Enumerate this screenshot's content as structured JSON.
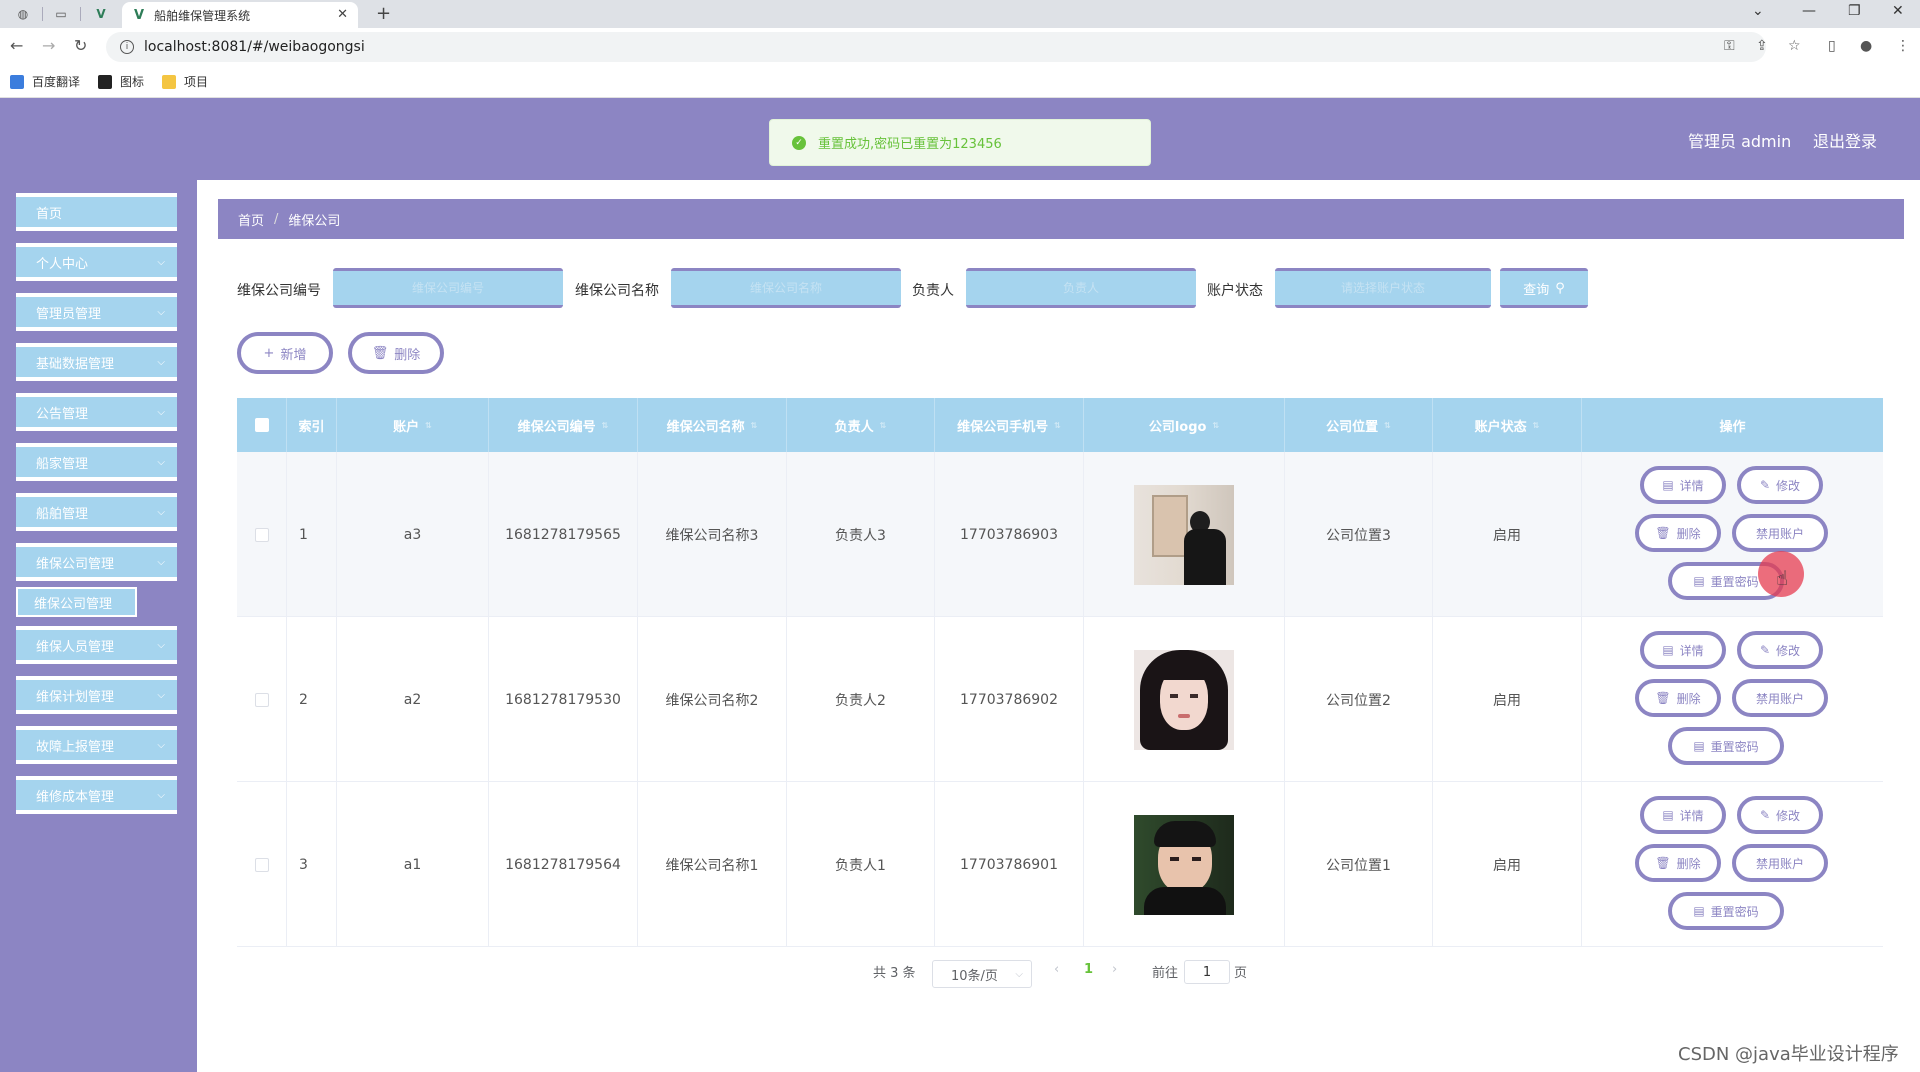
{
  "browser": {
    "tab_title": "船舶维保管理系统",
    "url": "localhost:8081/#/weibaogongsi",
    "bookmarks": [
      "百度翻译",
      "图标",
      "项目"
    ]
  },
  "header": {
    "toast": "重置成功,密码已重置为123456",
    "user": "管理员 admin",
    "logout": "退出登录"
  },
  "sidebar": {
    "items": [
      "首页",
      "个人中心",
      "管理员管理",
      "基础数据管理",
      "公告管理",
      "船家管理",
      "船舶管理",
      "维保公司管理",
      "维保人员管理",
      "维保计划管理",
      "故障上报管理",
      "维修成本管理"
    ],
    "sub_active": "维保公司管理"
  },
  "breadcrumb": {
    "home": "首页",
    "current": "维保公司"
  },
  "filters": {
    "code_label": "维保公司编号",
    "code_placeholder": "维保公司编号",
    "name_label": "维保公司名称",
    "name_placeholder": "维保公司名称",
    "owner_label": "负责人",
    "owner_placeholder": "负责人",
    "status_label": "账户状态",
    "status_placeholder": "请选择账户状态",
    "search": "查询"
  },
  "actions": {
    "add": "新增",
    "delete": "删除"
  },
  "table": {
    "columns": [
      "索引",
      "账户",
      "维保公司编号",
      "维保公司名称",
      "负责人",
      "维保公司手机号",
      "公司logo",
      "公司位置",
      "账户状态",
      "操作"
    ],
    "rows": [
      {
        "index": "1",
        "account": "a3",
        "code": "1681278179565",
        "name": "维保公司名称3",
        "owner": "负责人3",
        "phone": "17703786903",
        "location": "公司位置3",
        "status": "启用"
      },
      {
        "index": "2",
        "account": "a2",
        "code": "1681278179530",
        "name": "维保公司名称2",
        "owner": "负责人2",
        "phone": "17703786902",
        "location": "公司位置2",
        "status": "启用"
      },
      {
        "index": "3",
        "account": "a1",
        "code": "1681278179564",
        "name": "维保公司名称1",
        "owner": "负责人1",
        "phone": "17703786901",
        "location": "公司位置1",
        "status": "启用"
      }
    ],
    "ops": {
      "detail": "详情",
      "edit": "修改",
      "delete": "删除",
      "disable": "禁用账户",
      "reset": "重置密码"
    }
  },
  "pagination": {
    "total": "共 3 条",
    "page_size": "10条/页",
    "current": "1",
    "goto": "前往",
    "goto_value": "1",
    "page_unit": "页"
  },
  "watermark": "CSDN @java毕业设计程序",
  "colors": {
    "primary": "#8c85c3",
    "light_blue": "#a5d4ee",
    "success": "#67c23a"
  }
}
